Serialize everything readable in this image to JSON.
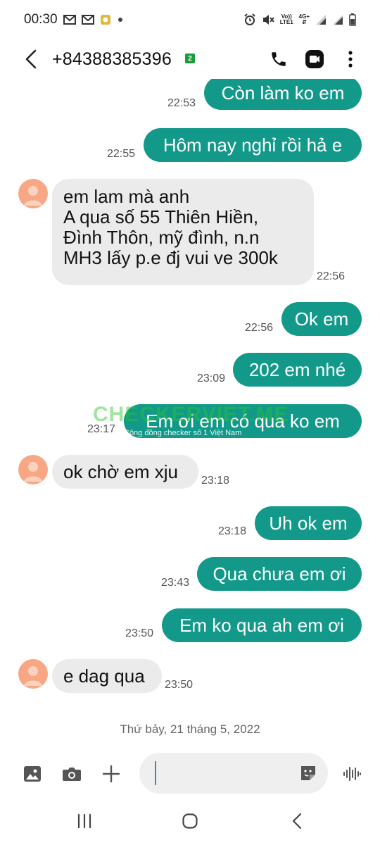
{
  "status_bar": {
    "time": "00:30",
    "network_top": "Vo))",
    "network_bottom": "LTE1",
    "data_top": "4G+",
    "icons": [
      "gmail-icon",
      "gmail-icon",
      "notification-app-icon",
      "dot-icon",
      "alarm-icon",
      "mute-icon",
      "signal-icon",
      "signal-icon",
      "battery-icon"
    ]
  },
  "header": {
    "contact": "+84388385396",
    "sim_badge": "2"
  },
  "messages": [
    {
      "dir": "out",
      "text": "Còn làm ko em",
      "time": "22:53"
    },
    {
      "dir": "out",
      "text": "Hôm nay nghỉ rồi hả e",
      "time": "22:55"
    },
    {
      "dir": "in",
      "lines": [
        "em lam mà anh",
        "A qua số 55 Thiên Hiền,",
        "Đình Thôn, mỹ đình, n.n",
        "MH3 lấy p.e đj vui ve 300k"
      ],
      "time": "22:56"
    },
    {
      "dir": "out",
      "text": "Ok em",
      "time": "22:56"
    },
    {
      "dir": "out",
      "text": "202 em nhé",
      "time": "23:09"
    },
    {
      "dir": "out",
      "text": "Em ơi em có qua ko em",
      "time": "23:17"
    },
    {
      "dir": "in",
      "text": "ok chờ em xju",
      "time": "23:18"
    },
    {
      "dir": "out",
      "text": "Uh ok em",
      "time": "23:18"
    },
    {
      "dir": "out",
      "text": "Qua chưa em ơi",
      "time": "23:43"
    },
    {
      "dir": "out",
      "text": "Em ko qua ah em ơi",
      "time": "23:50"
    },
    {
      "dir": "in",
      "text": "e dag qua",
      "time": "23:50"
    }
  ],
  "watermark": {
    "main": "CHECKERVIET.ME",
    "sub": "Cộng đồng checker số 1 Việt Nam"
  },
  "date_separator": "Thứ bảy, 21 tháng 5, 2022",
  "composer": {
    "value": ""
  },
  "colors": {
    "outgoing_bubble": "#12998a",
    "incoming_bubble": "#ebebeb",
    "avatar": "#f7a783",
    "sim_badge": "#1a9c3e"
  }
}
